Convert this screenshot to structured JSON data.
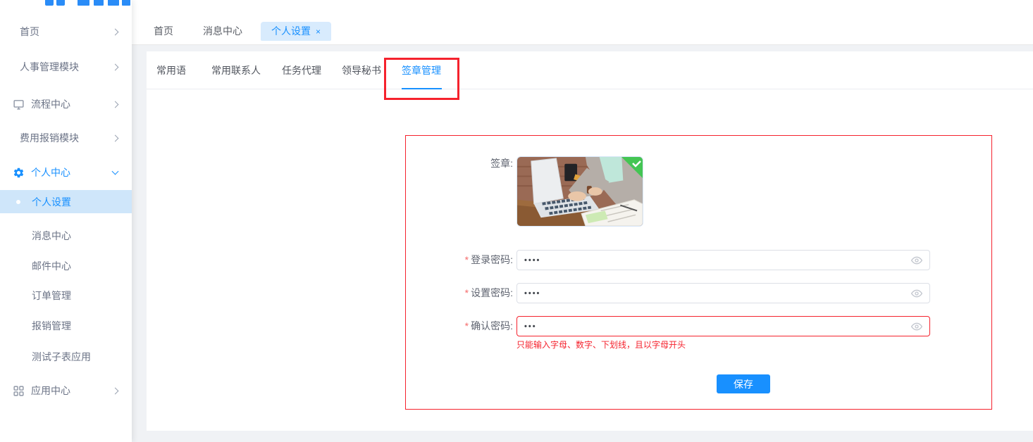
{
  "sidebar": {
    "items": [
      {
        "label": "首页",
        "chevron": "right"
      },
      {
        "label": "人事管理模块",
        "chevron": "right"
      },
      {
        "label": "流程中心",
        "icon": "monitor-icon",
        "chevron": "right"
      },
      {
        "label": "费用报销模块",
        "chevron": "right"
      },
      {
        "label": "个人中心",
        "icon": "gear-icon",
        "chevron": "down",
        "active": true
      },
      {
        "label": "应用中心",
        "icon": "grid-icon",
        "chevron": "right"
      }
    ],
    "submenu": [
      {
        "label": "个人设置",
        "active": true
      },
      {
        "label": "消息中心"
      },
      {
        "label": "邮件中心"
      },
      {
        "label": "订单管理"
      },
      {
        "label": "报销管理"
      },
      {
        "label": "测试子表应用"
      }
    ]
  },
  "tabbar": {
    "tabs": [
      {
        "label": "首页"
      },
      {
        "label": "消息中心"
      },
      {
        "label": "个人设置",
        "active": true,
        "close_label": "×"
      }
    ]
  },
  "subtabs": {
    "items": [
      "常用语",
      "常用联系人",
      "任务代理",
      "领导秘书",
      "签章管理"
    ],
    "active": "签章管理"
  },
  "form": {
    "signature": {
      "label": "签章:",
      "status_icon": "check-icon"
    },
    "fields": [
      {
        "required": "*",
        "label": "登录密码:",
        "value": "••••"
      },
      {
        "required": "*",
        "label": "设置密码:",
        "value": "••••"
      },
      {
        "required": "*",
        "label": "确认密码:",
        "value": "•••",
        "error": "只能输入字母、数字、下划线，且以字母开头"
      }
    ],
    "save_label": "保存"
  },
  "colors": {
    "accent_blue": "#1890ff",
    "sidebar_active_bg": "#cfe6fa",
    "tab_active_bg": "#d8ebfd",
    "error_red": "#f5222d",
    "required_red": "#f56c6c",
    "badge_green": "#44c553",
    "annotation_red": "#f5222d"
  }
}
